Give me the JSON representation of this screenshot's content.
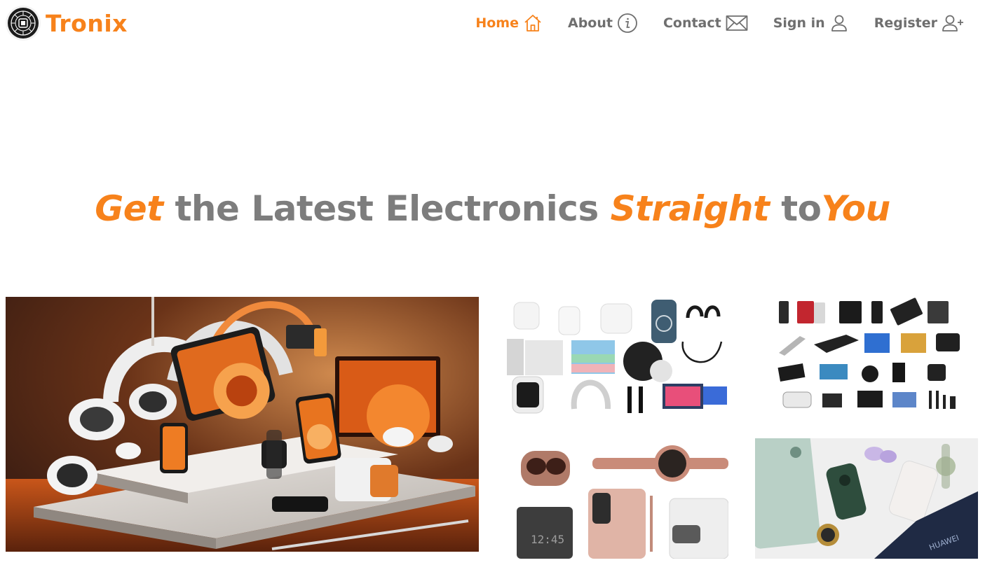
{
  "brand": {
    "name": "Tronix",
    "logo_icon": "circuit-seal-logo"
  },
  "nav": {
    "items": [
      {
        "label": "Home",
        "icon": "home-icon",
        "active": true
      },
      {
        "label": "About",
        "icon": "info-circle-icon",
        "active": false
      },
      {
        "label": "Contact",
        "icon": "envelope-icon",
        "active": false
      },
      {
        "label": "Sign in",
        "icon": "person-icon",
        "active": false
      },
      {
        "label": "Register",
        "icon": "person-plus-icon",
        "active": false
      }
    ]
  },
  "hero": {
    "word1": "Get",
    "word2": " the Latest Electronics ",
    "word3": "Straight",
    "word4": " to",
    "word5": "You"
  },
  "gallery": {
    "images": [
      "electronics-collage-orange",
      "apple-products-grid",
      "sony-products-grid",
      "samsung-wearables-phone",
      "huawei-devices-flatlay"
    ]
  },
  "colors": {
    "accent": "#f7821b",
    "text_muted": "#7d7d7d",
    "nav_text": "#6f6f6f"
  }
}
